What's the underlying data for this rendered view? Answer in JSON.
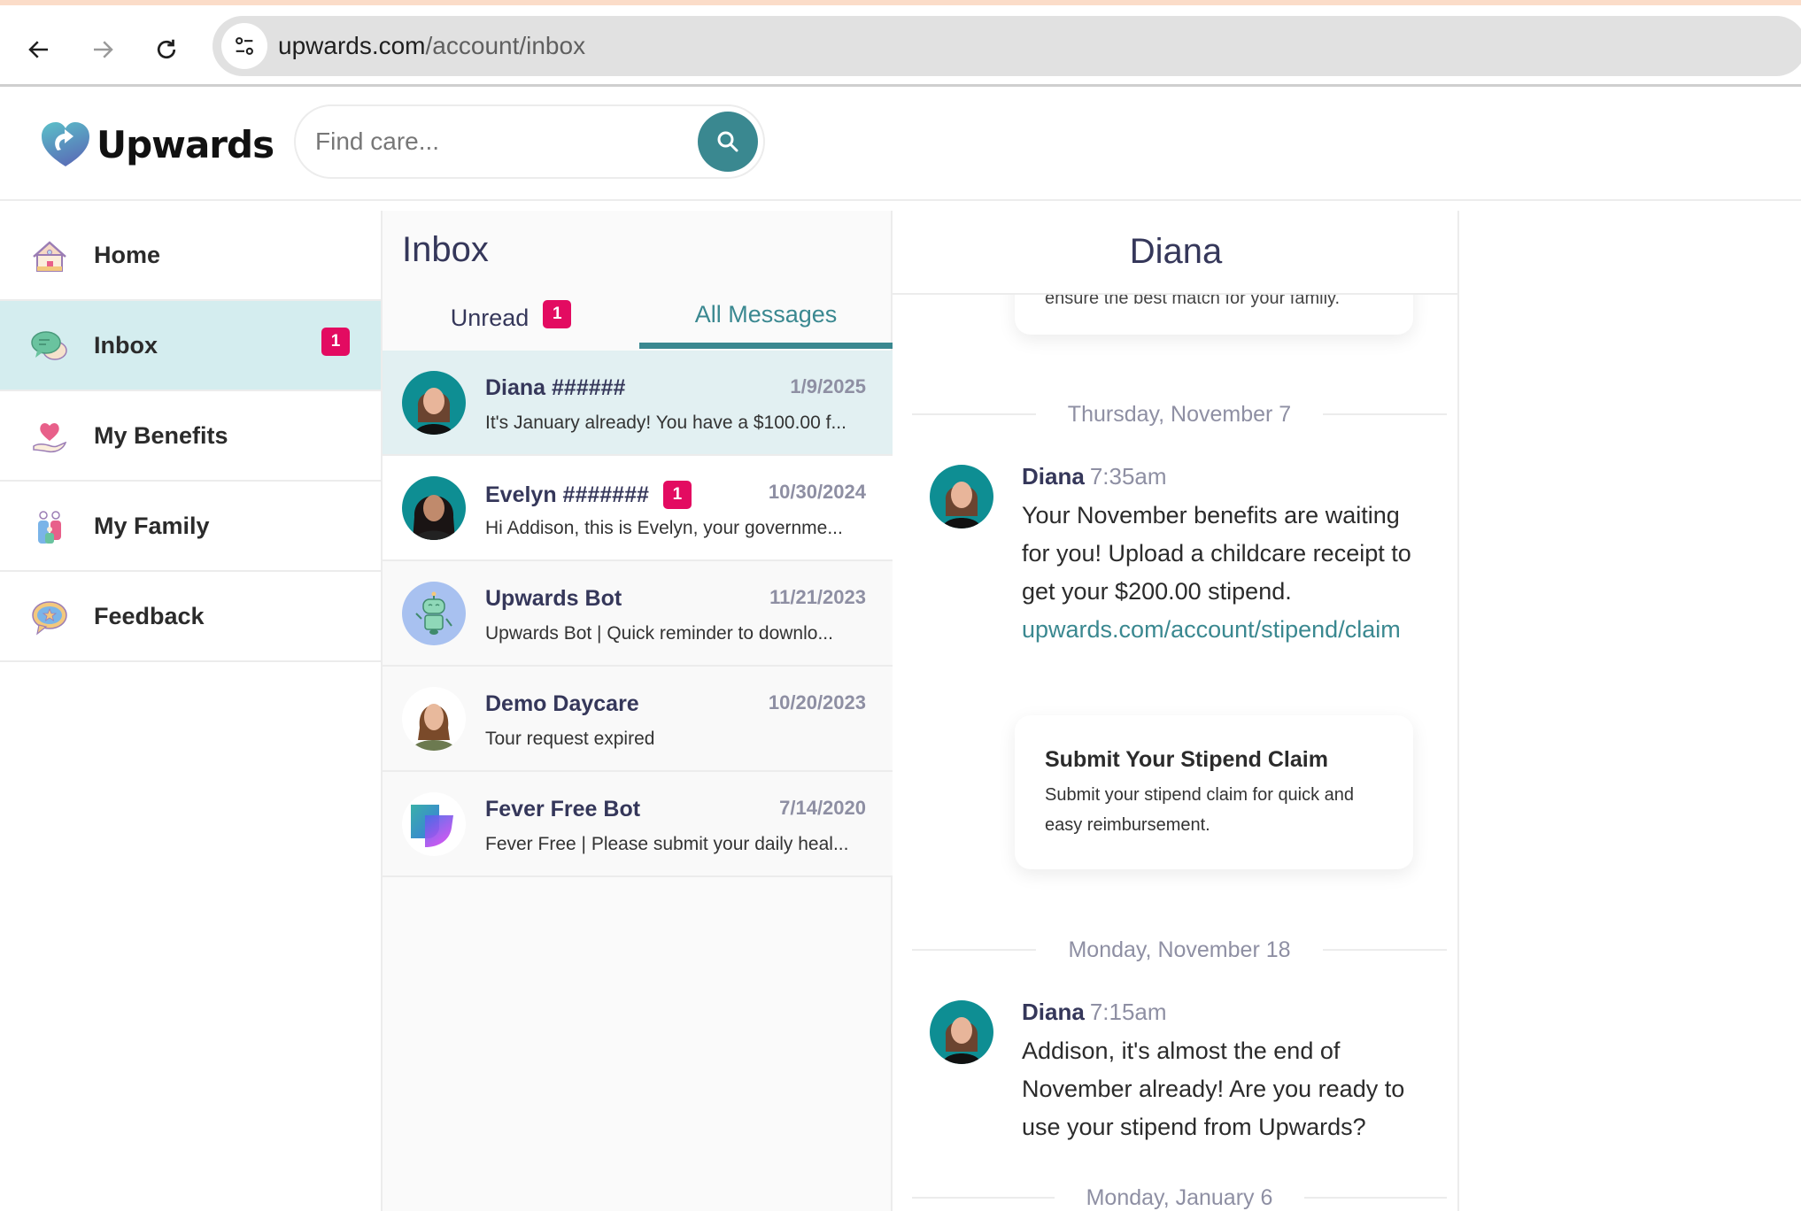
{
  "browser": {
    "url_domain": "upwards.com",
    "url_path": "/account/inbox"
  },
  "header": {
    "brand": "Upwards",
    "search_placeholder": "Find care..."
  },
  "sidebar": {
    "items": [
      {
        "label": "Home",
        "icon": "house-icon",
        "active": false
      },
      {
        "label": "Inbox",
        "icon": "chat-bubbles-icon",
        "active": true,
        "badge": "1"
      },
      {
        "label": "My Benefits",
        "icon": "heart-hand-icon",
        "active": false
      },
      {
        "label": "My Family",
        "icon": "family-icon",
        "active": false
      },
      {
        "label": "Feedback",
        "icon": "star-speech-icon",
        "active": false
      }
    ]
  },
  "inbox": {
    "title": "Inbox",
    "tabs": [
      {
        "label": "Unread",
        "badge": "1",
        "active": false
      },
      {
        "label": "All Messages",
        "active": true
      }
    ],
    "conversations": [
      {
        "name": "Diana ######",
        "date": "1/9/2025",
        "preview": "It's January already! You have a $100.00 f...",
        "selected": true
      },
      {
        "name": "Evelyn #######",
        "badge": "1",
        "date": "10/30/2024",
        "preview": "Hi Addison, this is Evelyn, your governme..."
      },
      {
        "name": "Upwards Bot",
        "date": "11/21/2023",
        "preview": "Upwards Bot | Quick reminder to downlo..."
      },
      {
        "name": "Demo Daycare",
        "date": "10/20/2023",
        "preview": "Tour request expired"
      },
      {
        "name": "Fever Free Bot",
        "date": "7/14/2020",
        "preview": "Fever Free | Please submit your daily heal..."
      }
    ]
  },
  "chat": {
    "title": "Diana",
    "top_card_cut_text": "ensure the best match for your family.",
    "sections": [
      {
        "date": "Thursday, November 7",
        "message": {
          "author": "Diana",
          "time": "7:35am",
          "body": "Your November benefits are waiting for you! Upload a childcare receipt to get your $200.00 stipend.",
          "link": "upwards.com/account/stipend/claim"
        },
        "card": {
          "title": "Submit Your Stipend Claim",
          "description": "Submit your stipend claim for quick and easy reimbursement."
        }
      },
      {
        "date": "Monday, November 18",
        "message": {
          "author": "Diana",
          "time": "7:15am",
          "body": "Addison, it's almost the end of November already! Are you ready to use your stipend from Upwards?"
        }
      },
      {
        "date": "Monday, January 6"
      }
    ]
  },
  "colors": {
    "accent_teal": "#3a8890",
    "badge_pink": "#e30b61",
    "active_sidebar_bg": "#d4edef",
    "selected_row_bg": "#e2f0f2",
    "heading_navy": "#35375a",
    "muted_gray": "#8e8fa3"
  }
}
